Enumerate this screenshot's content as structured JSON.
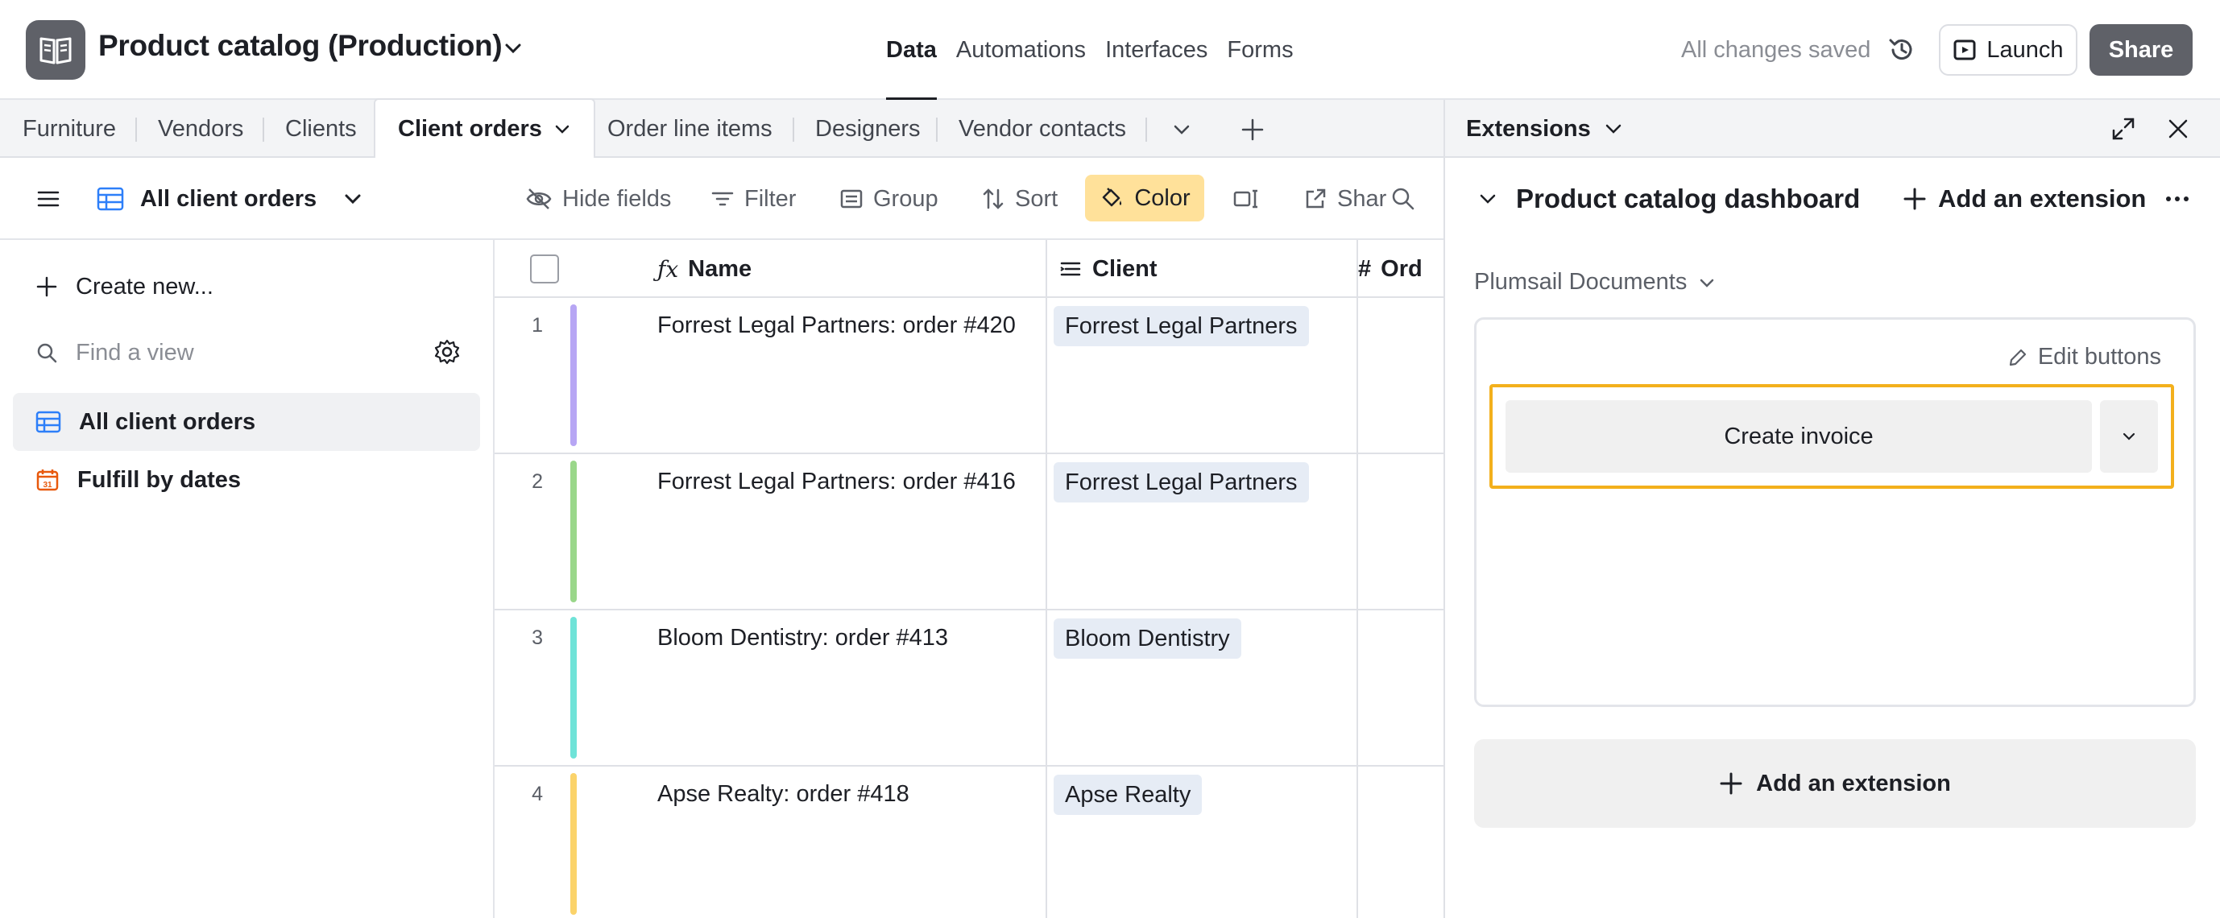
{
  "app": {
    "base_title": "Product catalog (Production)",
    "nav": [
      "Data",
      "Automations",
      "Interfaces",
      "Forms"
    ],
    "active_nav": "Data",
    "save_status": "All changes saved",
    "launch_label": "Launch",
    "share_label": "Share"
  },
  "tables": {
    "tabs": [
      "Furniture",
      "Vendors",
      "Clients",
      "Client orders",
      "Order line items",
      "Designers",
      "Vendor contacts"
    ],
    "active": "Client orders"
  },
  "viewbar": {
    "view_name": "All client orders",
    "hide_fields": "Hide fields",
    "filter": "Filter",
    "group": "Group",
    "sort": "Sort",
    "color": "Color",
    "share_partial": "Shar"
  },
  "sidebar": {
    "create_new": "Create new...",
    "find_placeholder": "Find a view",
    "views": [
      {
        "label": "All client orders",
        "active": true,
        "icon": "grid-view-icon"
      },
      {
        "label": "Fulfill by dates",
        "active": false,
        "icon": "calendar-icon"
      }
    ]
  },
  "grid": {
    "columns": [
      "Name",
      "Client",
      "Ord"
    ],
    "rows": [
      {
        "num": "1",
        "name": "Forrest Legal Partners: order #420",
        "client": "Forrest Legal Partners",
        "color": "#b7a6f4"
      },
      {
        "num": "2",
        "name": "Forrest Legal Partners: order #416",
        "client": "Forrest Legal Partners",
        "color": "#9ad78a"
      },
      {
        "num": "3",
        "name": "Bloom Dentistry: order #413",
        "client": "Bloom Dentistry",
        "color": "#6fe3d8"
      },
      {
        "num": "4",
        "name": "Apse Realty: order #418",
        "client": "Apse Realty",
        "color": "#fbd36a"
      }
    ]
  },
  "extensions": {
    "panel_title": "Extensions",
    "dashboard_title": "Product catalog dashboard",
    "add_extension": "Add an extension",
    "extension_name": "Plumsail Documents",
    "edit_buttons": "Edit buttons",
    "create_invoice": "Create invoice",
    "highlight_color": "#f3b01c"
  }
}
